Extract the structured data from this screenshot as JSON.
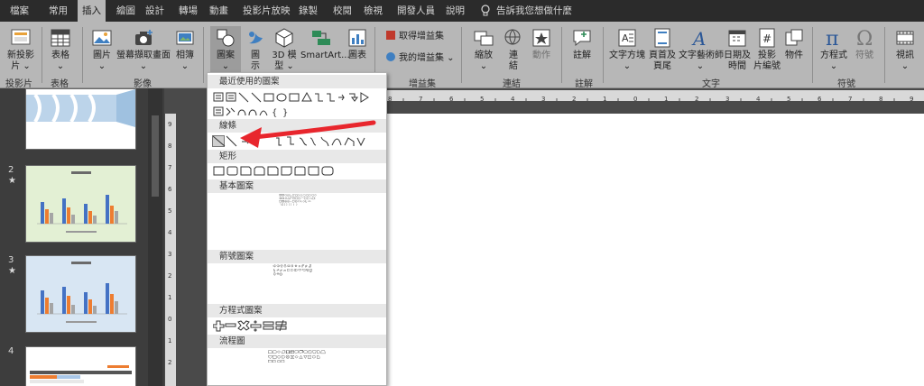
{
  "menu": {
    "tabs": [
      "檔案",
      "常用",
      "插入",
      "繪圖",
      "設計",
      "轉場",
      "動畫",
      "投影片放映",
      "錄製",
      "校閱",
      "檢視",
      "開發人員",
      "說明"
    ],
    "active_tab": "插入",
    "tell_me": "告訴我您想做什麼"
  },
  "ribbon": {
    "new_slide": [
      "新投影",
      "片 ⌄"
    ],
    "table": [
      "表格",
      "⌄"
    ],
    "picture": [
      "圖片",
      "⌄"
    ],
    "screenshot": [
      "螢幕擷取畫面",
      "⌄"
    ],
    "album": [
      "相簿",
      "⌄"
    ],
    "shapes": [
      "圖案",
      "⌄"
    ],
    "icons": [
      "圖",
      "示"
    ],
    "model3d": [
      "3D 模",
      "型 ⌄"
    ],
    "smartart": "SmartArt...",
    "chart": "圖表",
    "get_addins": "取得增益集",
    "my_addins": "我的增益集 ⌄",
    "zoom": [
      "縮放",
      "⌄"
    ],
    "link": [
      "連",
      "結"
    ],
    "action": "動作",
    "comment": "註解",
    "textbox": [
      "文字方塊",
      "⌄"
    ],
    "header_footer": [
      "頁首及",
      "頁尾"
    ],
    "wordart": [
      "文字藝術師",
      "⌄"
    ],
    "datetime": [
      "日期及",
      "時間"
    ],
    "slide_number": [
      "投影",
      "片編號"
    ],
    "object": "物件",
    "equation": [
      "方程式",
      "⌄"
    ],
    "symbol": "符號",
    "video": [
      "視訊",
      "⌄"
    ],
    "groups": {
      "slides": "投影片",
      "tables": "表格",
      "images": "影像",
      "addins": "增益集",
      "links": "連結",
      "comments": "註解",
      "text": "文字",
      "symbols": "符號"
    }
  },
  "shapes_menu": {
    "categories": [
      "最近使用的圖案",
      "線條",
      "矩形",
      "基本圖案",
      "箭號圖案",
      "方程式圖案",
      "流程圖"
    ]
  },
  "slides": {
    "numbers": [
      "2",
      "3",
      "4"
    ],
    "star": "★"
  },
  "colors": {
    "ribbon": "#b7b7b7",
    "annotation_arrow": "#e8262d",
    "slide2_bg": "#e3f0d4",
    "slide3_bg": "#d8e6f3",
    "bar_blue": "#4472c4",
    "bar_orange": "#ed7d31"
  }
}
